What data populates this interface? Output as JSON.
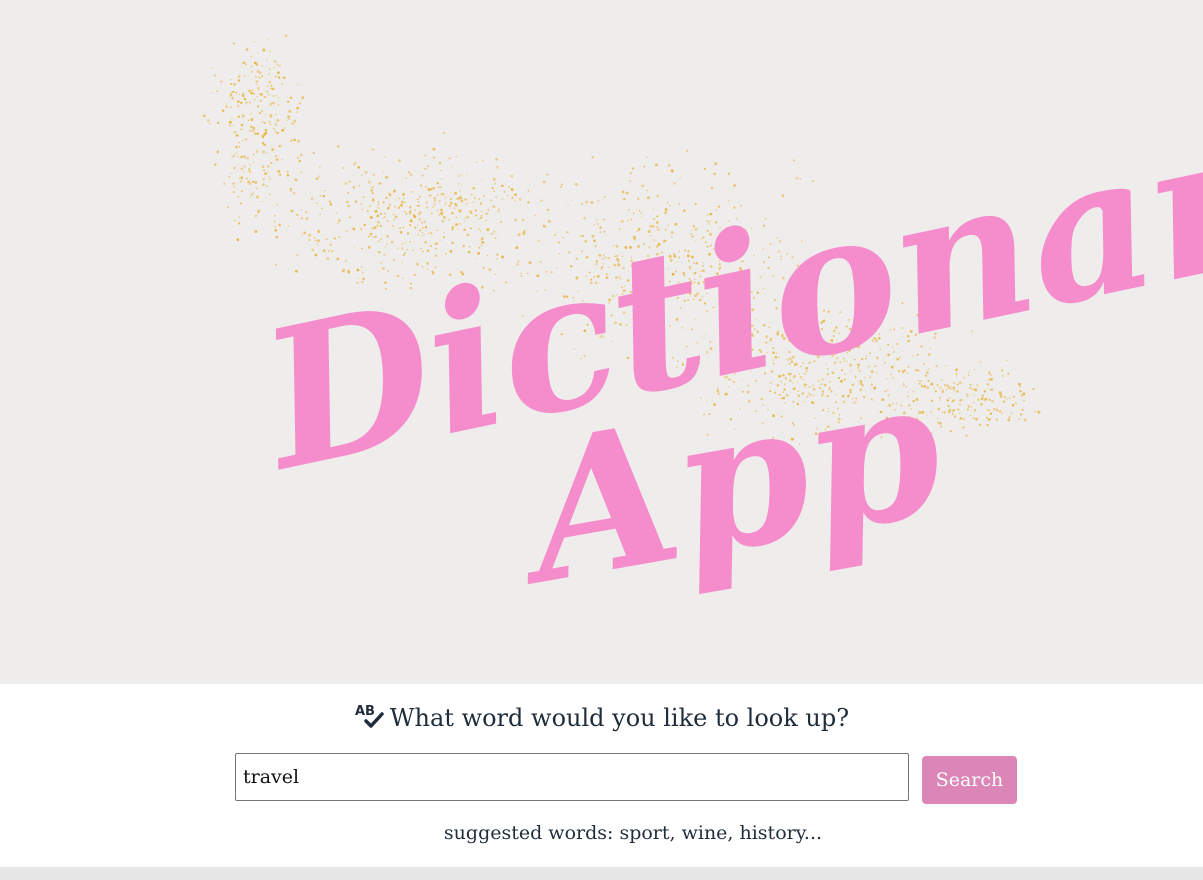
{
  "logo": {
    "line1": "Dictionary",
    "line2": "App",
    "accent_color": "#f58ccb",
    "glitter_color": "#e7b53d"
  },
  "prompt": {
    "icon": "spellcheck-icon",
    "text": "What word would you like to look up?"
  },
  "search": {
    "value": "travel",
    "placeholder": "",
    "button_label": "Search",
    "button_color": "#db86b6"
  },
  "suggestions": {
    "text": "suggested words: sport, wine, history..."
  }
}
